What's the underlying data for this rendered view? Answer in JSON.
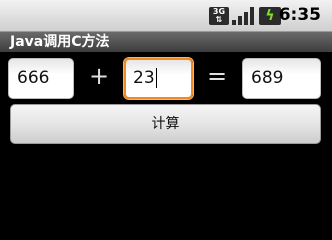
{
  "status_bar": {
    "network_label": "3G",
    "clock": "6:35",
    "icons": [
      "network-3g-icon",
      "signal-icon",
      "battery-charging-icon"
    ],
    "battery_color": "#7ee02a"
  },
  "app": {
    "title": "Java调用C方法"
  },
  "calculator": {
    "operand1": "666",
    "operator": "+",
    "operand2": "23",
    "equals": "=",
    "result": "689",
    "button_label": "计算",
    "focus_color": "#f28a1e"
  }
}
